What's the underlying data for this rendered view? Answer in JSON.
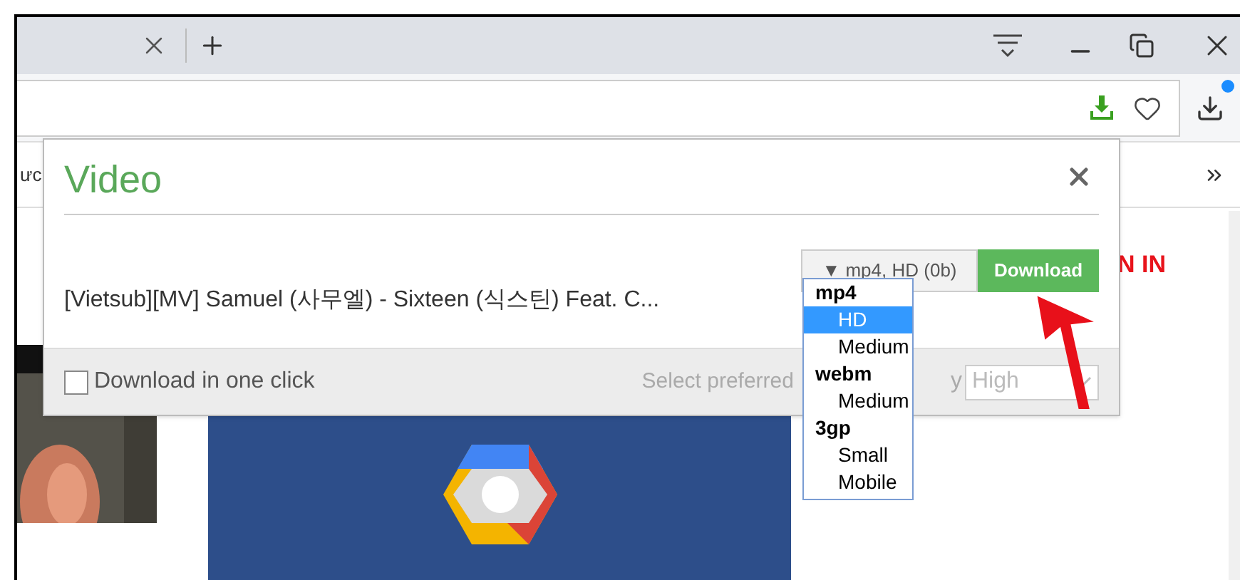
{
  "bookmarks_bar": {
    "fragment": "ưc"
  },
  "page": {
    "sign_in_fragment": "N IN"
  },
  "popup": {
    "title": "Video",
    "video_title": "[Vietsub][MV] Samuel (사무엘) - Sixteen (식스틴) Feat. C...",
    "format_select": {
      "value": "▼ mp4, HD (0b)"
    },
    "download_button": "Download",
    "one_click": {
      "label": "Download in one click",
      "checked": false
    },
    "quality": {
      "label_start": "Select preferred",
      "label_end": "y",
      "value": "High"
    }
  },
  "format_list": [
    {
      "kind": "group",
      "label": "mp4"
    },
    {
      "kind": "option",
      "label": "HD",
      "selected": true
    },
    {
      "kind": "option",
      "label": "Medium",
      "selected": false
    },
    {
      "kind": "group",
      "label": "webm"
    },
    {
      "kind": "option",
      "label": "Medium",
      "selected": false
    },
    {
      "kind": "group",
      "label": "3gp"
    },
    {
      "kind": "option",
      "label": "Small",
      "selected": false
    },
    {
      "kind": "option",
      "label": "Mobile",
      "selected": false
    }
  ]
}
